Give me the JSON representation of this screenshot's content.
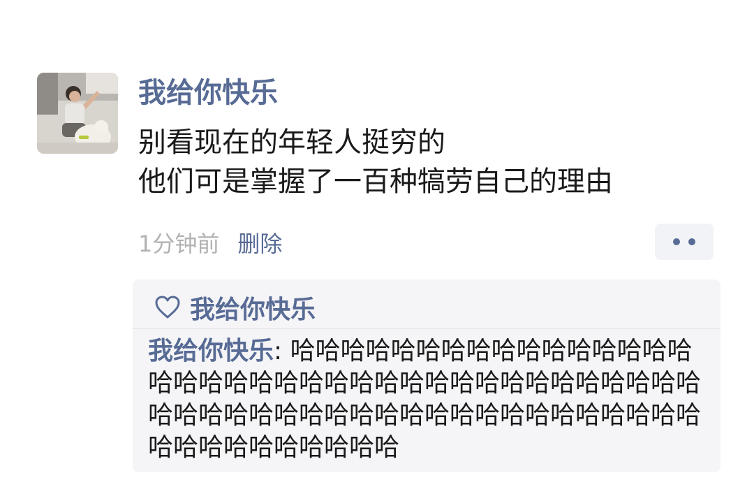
{
  "post": {
    "author": "我给你快乐",
    "content_lines": [
      "别看现在的年轻人挺穷的",
      "他们可是掌握了一百种犒劳自己的理由"
    ],
    "time": "1分钟前",
    "delete_label": "删除",
    "more_icon": "more-dots-icon"
  },
  "feedback": {
    "like_icon": "heart-outline-icon",
    "likers": "我给你快乐",
    "comment": {
      "author": "我给你快乐",
      "separator": ": ",
      "text": "哈哈哈哈哈哈哈哈哈哈哈哈哈哈哈哈哈哈哈哈哈哈哈哈哈哈哈哈哈哈哈哈哈哈哈哈哈哈哈哈哈哈哈哈哈哈哈哈哈哈哈哈哈哈哈哈哈哈哈哈哈哈哈哈哈哈哈哈哈哈"
    }
  },
  "colors": {
    "link": "#576b95",
    "text": "#1a1a1a",
    "muted": "#b2b2b2",
    "panel": "#f5f5f7"
  }
}
